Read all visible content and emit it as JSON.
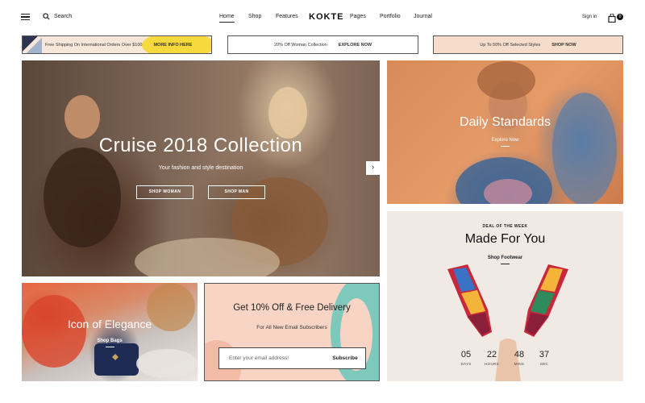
{
  "header": {
    "search_label": "Search",
    "nav": [
      {
        "label": "Home",
        "active": true
      },
      {
        "label": "Shop"
      },
      {
        "label": "Features"
      },
      {
        "label": "Pages"
      },
      {
        "label": "Portfolio"
      },
      {
        "label": "Journal"
      }
    ],
    "logo": "KOKTE",
    "signin": "Sign in",
    "cart_count": "0"
  },
  "promos": [
    {
      "text": "Free Shipping On International Orders Over $100",
      "link": "MORE INFO HERE"
    },
    {
      "text": "20% Off Woman Collection",
      "link": "EXPLORE NOW"
    },
    {
      "text": "Up To 50% Off Selected Styles",
      "link": "SHOP NOW"
    }
  ],
  "hero": {
    "title": "Cruise 2018 Collection",
    "subtitle": "Your fashion and style destination",
    "buttons": [
      "SHOP WOMAN",
      "SHOP MAN"
    ],
    "next_arrow": "›"
  },
  "daily": {
    "title": "Daily Standards",
    "link": "Explore Now"
  },
  "deal": {
    "kicker": "DEAL OF THE WEEK",
    "title": "Made For You",
    "link": "Shop Footwear",
    "countdown": [
      {
        "value": "05",
        "label": "DAYS"
      },
      {
        "value": "22",
        "label": "HOURS"
      },
      {
        "value": "48",
        "label": "MINS"
      },
      {
        "value": "37",
        "label": "SEC"
      }
    ]
  },
  "elegance": {
    "title": "Icon of Elegance",
    "link": "Shop Bags"
  },
  "newsletter": {
    "title": "Get 10% Off & Free Delivery",
    "subtitle": "For All New Email Subscribers",
    "placeholder": "Enter your email address!",
    "button": "Subscribe"
  },
  "colors": {
    "promo1_bg": "#f7e6da",
    "promo3_bg": "#f5dccb",
    "deal_bg": "#f1e9e4",
    "newsletter_bg": "#f7d4c3",
    "newsletter_accent": "#7ec9bb"
  }
}
